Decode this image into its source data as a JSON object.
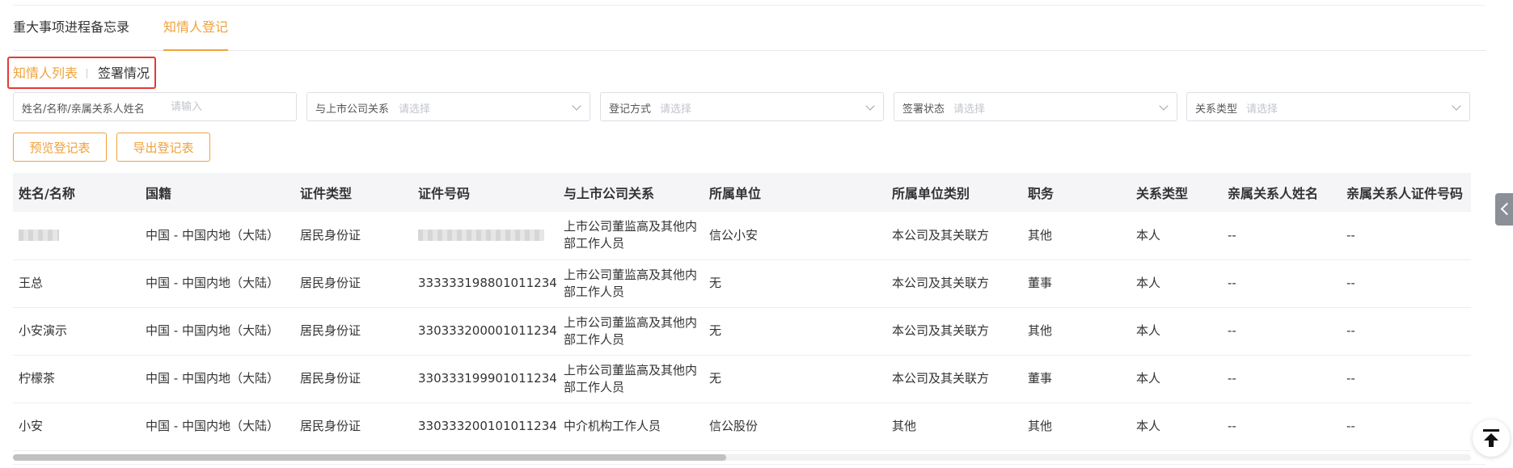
{
  "tabs": [
    {
      "label": "重大事项进程备忘录",
      "active": false
    },
    {
      "label": "知情人登记",
      "active": true
    }
  ],
  "subtabs": [
    {
      "label": "知情人列表",
      "active": true
    },
    {
      "label": "签署情况",
      "active": false
    }
  ],
  "filters": {
    "name": {
      "label": "姓名/名称/亲属关系人姓名",
      "placeholder": "请输入"
    },
    "relation": {
      "label": "与上市公司关系",
      "placeholder": "请选择"
    },
    "method": {
      "label": "登记方式",
      "placeholder": "请选择"
    },
    "sign_status": {
      "label": "签署状态",
      "placeholder": "请选择"
    },
    "relation_type": {
      "label": "关系类型",
      "placeholder": "请选择"
    }
  },
  "buttons": {
    "preview": "预览登记表",
    "export": "导出登记表"
  },
  "table": {
    "headers": [
      "姓名/名称",
      "国籍",
      "证件类型",
      "证件号码",
      "与上市公司关系",
      "所属单位",
      "所属单位类别",
      "职务",
      "关系类型",
      "亲属关系人姓名",
      "亲属关系人证件号码"
    ],
    "rows": [
      [
        "",
        "中国 - 中国内地（大陆）",
        "居民身份证",
        "",
        "上市公司董监高及其他内部工作人员",
        "信公小安",
        "本公司及其关联方",
        "其他",
        "本人",
        "--",
        "--"
      ],
      [
        "王总",
        "中国 - 中国内地（大陆）",
        "居民身份证",
        "333333198801011234",
        "上市公司董监高及其他内部工作人员",
        "无",
        "本公司及其关联方",
        "董事",
        "本人",
        "--",
        "--"
      ],
      [
        "小安演示",
        "中国 - 中国内地（大陆）",
        "居民身份证",
        "330333200001011234",
        "上市公司董监高及其他内部工作人员",
        "无",
        "本公司及其关联方",
        "其他",
        "本人",
        "--",
        "--"
      ],
      [
        "柠檬茶",
        "中国 - 中国内地（大陆）",
        "居民身份证",
        "330333199901011234",
        "上市公司董监高及其他内部工作人员",
        "无",
        "本公司及其关联方",
        "董事",
        "本人",
        "--",
        "--"
      ],
      [
        "小安",
        "中国 - 中国内地（大陆）",
        "居民身份证",
        "330333200101011234",
        "中介机构工作人员",
        "信公股份",
        "其他",
        "其他",
        "本人",
        "--",
        "--"
      ]
    ]
  },
  "colors": {
    "accent": "#f0a23a",
    "highlight_border": "#e53935"
  },
  "icons": {
    "side_tab": "chevron-left-icon",
    "back_to_top": "arrow-up-bar-icon"
  }
}
